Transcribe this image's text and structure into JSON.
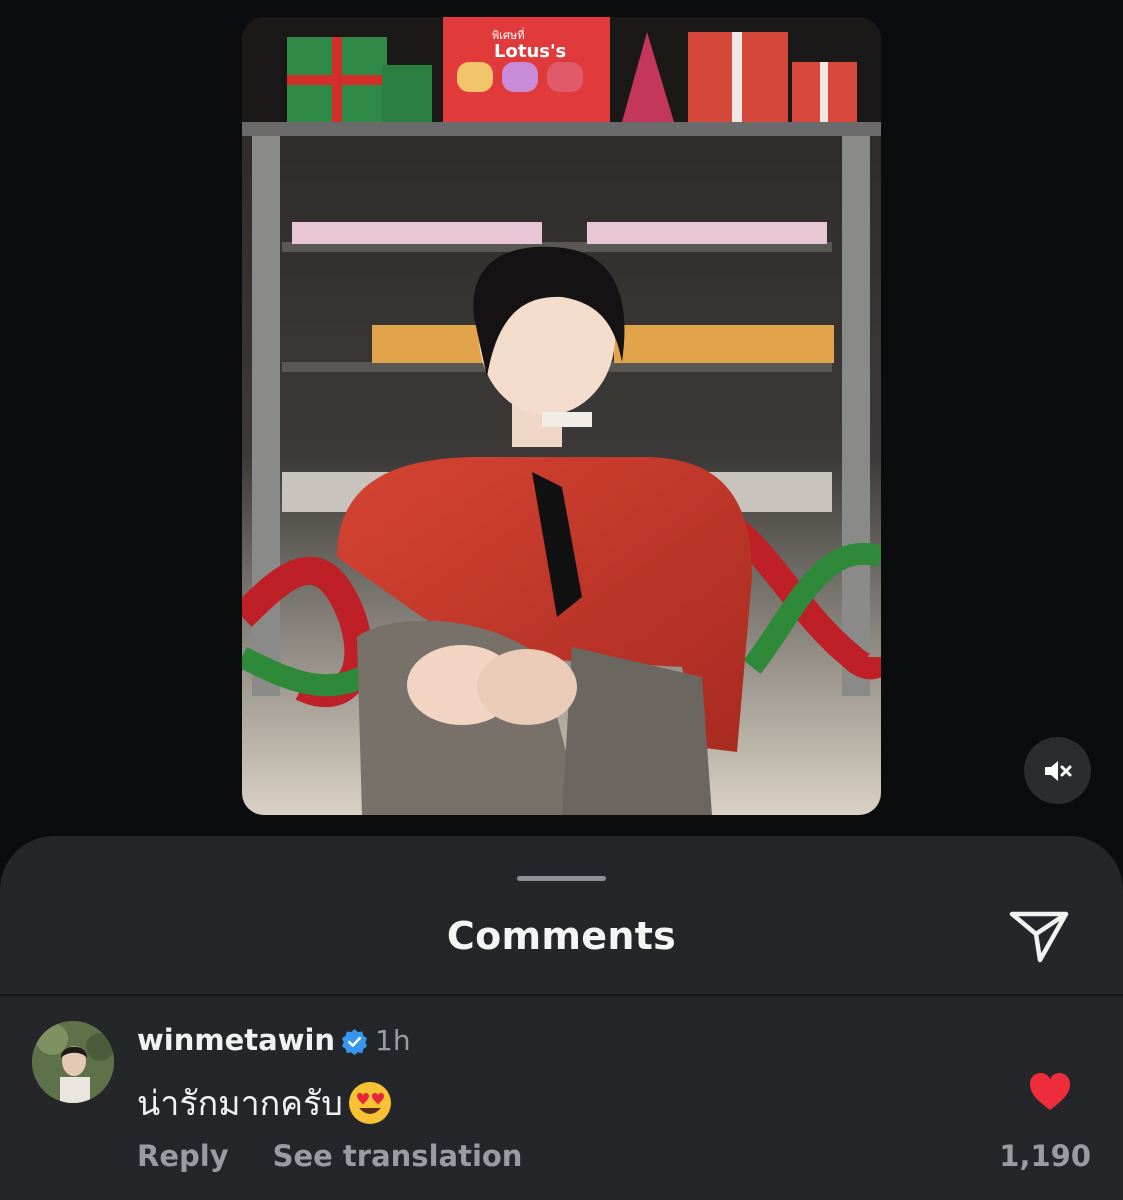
{
  "media": {
    "icons": {
      "sound": "speaker-muted-icon"
    },
    "shop_sign": {
      "brand": "Lotus's",
      "tag": "พิเศษที่"
    }
  },
  "comments_sheet": {
    "title": "Comments",
    "share_icon": "paper-plane-icon"
  },
  "comment": {
    "username": "winmetawin",
    "verified": true,
    "time": "1h",
    "text": "น่ารักมากครับ",
    "emoji": "heart-eyes",
    "reply_label": "Reply",
    "translate_label": "See translation",
    "likes": "1,190",
    "liked": true
  },
  "colors": {
    "background": "#0b0c0e",
    "sheet": "#24262a",
    "muted_text": "#9a9ca2",
    "verified_blue": "#3797f0",
    "like_red": "#ed2d3a"
  }
}
